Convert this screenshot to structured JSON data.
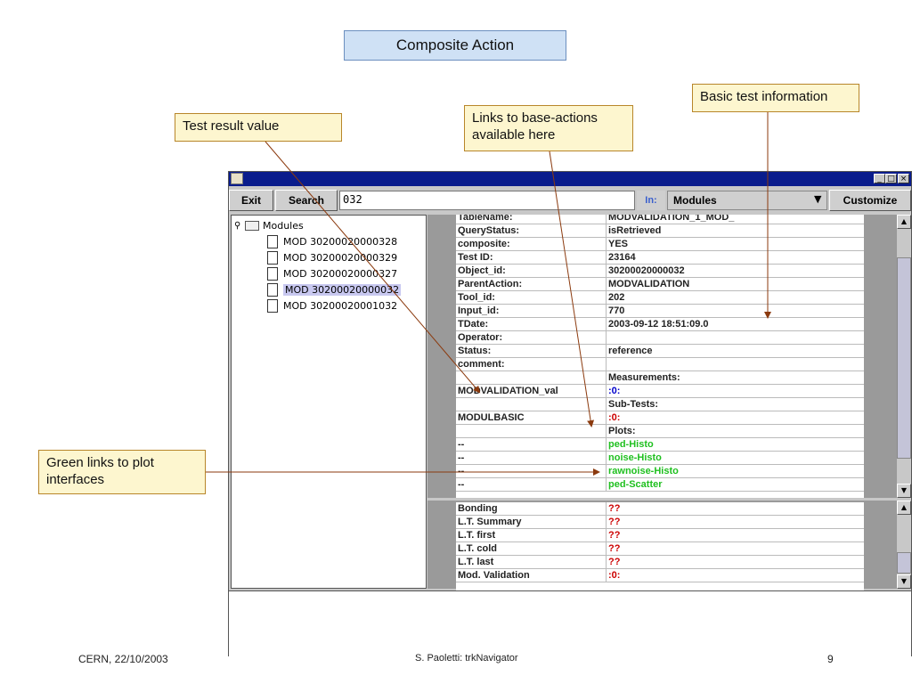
{
  "slide": {
    "title": "Composite Action",
    "footer_left": "CERN, 22/10/2003",
    "footer_center": "S. Paoletti: trkNavigator",
    "page_number": "9"
  },
  "callouts": {
    "test_result": "Test result value",
    "links_base_line1": "Links to base-actions",
    "links_base_line2": "available here",
    "basic_info": "Basic test information",
    "green_links_line1": "Green links to plot",
    "green_links_line2": "interfaces"
  },
  "app": {
    "toolbar": {
      "exit_label": "Exit",
      "search_label": "Search",
      "search_value": "032",
      "in_label": "In:",
      "scope_value": "Modules",
      "customize_label": "Customize"
    },
    "tree": {
      "root": "Modules",
      "items": [
        {
          "label": "MOD 30200020000328",
          "selected": false
        },
        {
          "label": "MOD 30200020000329",
          "selected": false
        },
        {
          "label": "MOD 30200020000327",
          "selected": false
        },
        {
          "label": "MOD 30200020000032",
          "selected": true
        },
        {
          "label": "MOD 30200020001032",
          "selected": false
        }
      ]
    },
    "main_table": [
      {
        "key": "TableName:",
        "value": "MODVALIDATION_1_MOD_",
        "style": ""
      },
      {
        "key": "QueryStatus:",
        "value": "isRetrieved",
        "style": ""
      },
      {
        "key": "composite:",
        "value": "YES",
        "style": ""
      },
      {
        "key": "Test ID:",
        "value": "23164",
        "style": ""
      },
      {
        "key": "Object_id:",
        "value": "30200020000032",
        "style": ""
      },
      {
        "key": "ParentAction:",
        "value": "MODVALIDATION",
        "style": ""
      },
      {
        "key": "Tool_id:",
        "value": "202",
        "style": ""
      },
      {
        "key": "Input_id:",
        "value": "770",
        "style": ""
      },
      {
        "key": "TDate:",
        "value": "2003-09-12 18:51:09.0",
        "style": ""
      },
      {
        "key": "Operator:",
        "value": "",
        "style": ""
      },
      {
        "key": "Status:",
        "value": "reference",
        "style": ""
      },
      {
        "key": "comment:",
        "value": "",
        "style": ""
      },
      {
        "key": "",
        "value": "Measurements:",
        "style": ""
      },
      {
        "key": "MODVALIDATION_val",
        "value": ":0:",
        "style": "link"
      },
      {
        "key": "",
        "value": "Sub-Tests:",
        "style": ""
      },
      {
        "key": "MODULBASIC",
        "value": ":0:",
        "style": "red"
      },
      {
        "key": "",
        "value": "Plots:",
        "style": ""
      },
      {
        "key": "--",
        "value": "ped-Histo",
        "style": "green"
      },
      {
        "key": "--",
        "value": "noise-Histo",
        "style": "green"
      },
      {
        "key": "--",
        "value": "rawnoise-Histo",
        "style": "green"
      },
      {
        "key": "--",
        "value": "ped-Scatter",
        "style": "green"
      }
    ],
    "summary_table": [
      {
        "key": "Bonding",
        "value": "??",
        "style": "red"
      },
      {
        "key": "L.T. Summary",
        "value": "??",
        "style": "red"
      },
      {
        "key": "L.T. first",
        "value": "??",
        "style": "red"
      },
      {
        "key": "L.T. cold",
        "value": "??",
        "style": "red"
      },
      {
        "key": "L.T. last",
        "value": "??",
        "style": "red"
      },
      {
        "key": "Mod. Validation",
        "value": ":0:",
        "style": "red"
      }
    ],
    "colors": {
      "titlebar": "#0a1c8c",
      "link_blue": "#0000cc",
      "plot_green": "#20c020",
      "value_red": "#cc0000",
      "callout_fill": "#fdf6cf",
      "callout_border": "#b8862a",
      "arrow": "#8b3a0e"
    }
  }
}
